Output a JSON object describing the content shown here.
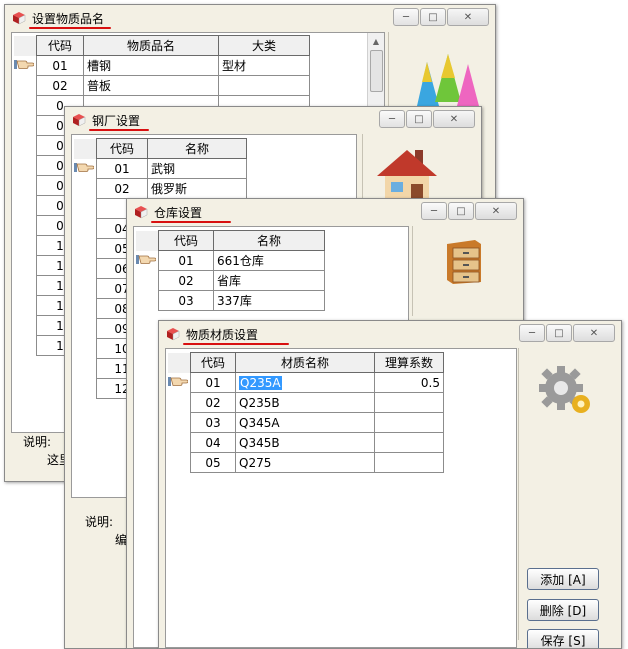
{
  "w1": {
    "title": "设置物质品名",
    "headers": [
      "代码",
      "物质品名",
      "大类"
    ],
    "rows": [
      [
        "01",
        "槽钢",
        "型材"
      ],
      [
        "02",
        "普板",
        ""
      ],
      [
        "0",
        "",
        ""
      ],
      [
        "0",
        "",
        ""
      ],
      [
        "0",
        "",
        ""
      ],
      [
        "0",
        "",
        ""
      ],
      [
        "0",
        "",
        ""
      ],
      [
        "0",
        "",
        ""
      ],
      [
        "0",
        "",
        ""
      ],
      [
        "1",
        "",
        ""
      ],
      [
        "1",
        "",
        ""
      ],
      [
        "1",
        "",
        ""
      ],
      [
        "1",
        "",
        ""
      ],
      [
        "1",
        "",
        ""
      ],
      [
        "1",
        "",
        ""
      ]
    ],
    "footer_label": "说明:",
    "footer_text": "这里"
  },
  "w2": {
    "title": "钢厂设置",
    "headers": [
      "代码",
      "名称"
    ],
    "rows": [
      [
        "01",
        "武钢"
      ],
      [
        "02",
        "俄罗斯"
      ],
      [
        "",
        ""
      ],
      [
        "04",
        ""
      ],
      [
        "05",
        ""
      ],
      [
        "06",
        ""
      ],
      [
        "07",
        ""
      ],
      [
        "08",
        ""
      ],
      [
        "09",
        ""
      ],
      [
        "10",
        ""
      ],
      [
        "11",
        ""
      ],
      [
        "12",
        ""
      ]
    ],
    "footer_label": "说明:",
    "footer_text": "编"
  },
  "w3": {
    "title": "仓库设置",
    "headers": [
      "代码",
      "名称"
    ],
    "rows": [
      [
        "01",
        "661仓库"
      ],
      [
        "02",
        "省库"
      ],
      [
        "03",
        "337库"
      ]
    ]
  },
  "w4": {
    "title": "物质材质设置",
    "headers": [
      "代码",
      "材质名称",
      "理算系数"
    ],
    "rows": [
      [
        "01",
        "Q235A",
        "0.5"
      ],
      [
        "02",
        "Q235B",
        ""
      ],
      [
        "03",
        "Q345A",
        ""
      ],
      [
        "04",
        "Q345B",
        ""
      ],
      [
        "05",
        "Q275",
        ""
      ]
    ],
    "buttons": {
      "add": "添加 [A]",
      "delete": "删除 [D]",
      "save": "保存 [S]"
    }
  },
  "icons": [
    "cube-icon",
    "pointer-hand-icon",
    "cones-icon",
    "house-icon",
    "cabinet-icon",
    "gear-icon",
    "minimize-icon",
    "maximize-icon",
    "close-icon"
  ],
  "colors": {
    "window_bg": "#f3f0e4",
    "title_underline": "#d81010",
    "selection": "#3399ff"
  }
}
